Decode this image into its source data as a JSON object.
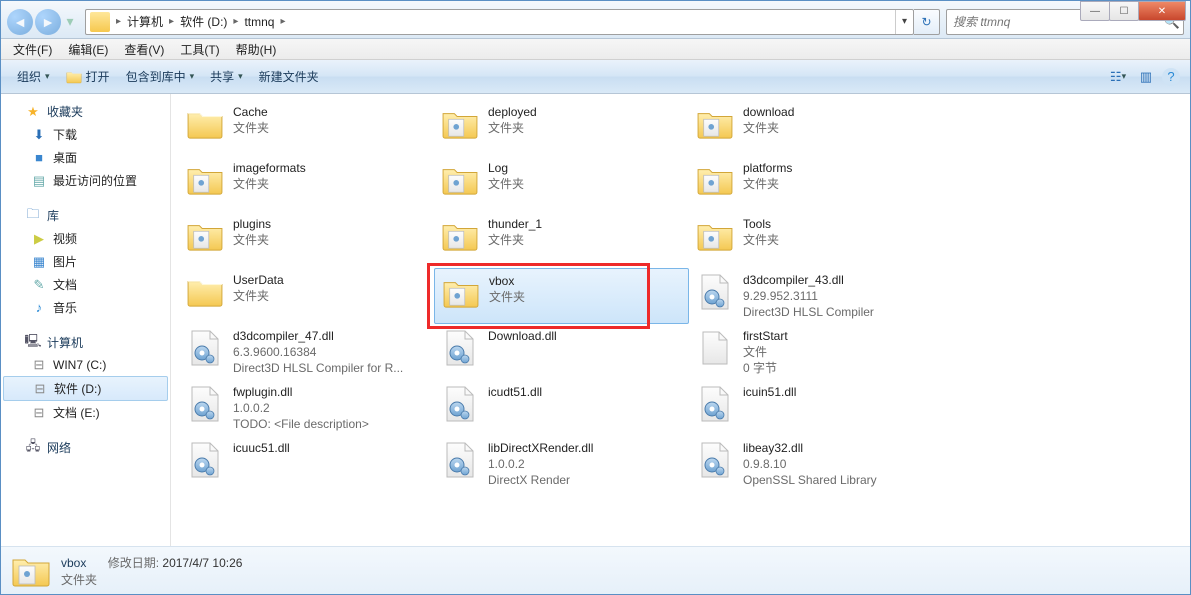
{
  "win_controls": {
    "min": "—",
    "max": "☐",
    "close": "✕"
  },
  "address": {
    "segments": [
      "计算机",
      "软件 (D:)",
      "ttmnq"
    ],
    "refresh_glyph": "↻",
    "dropdown_glyph": "▾"
  },
  "search": {
    "placeholder": "搜索 ttmnq",
    "icon_glyph": "🔍"
  },
  "menubar": [
    "文件(F)",
    "编辑(E)",
    "查看(V)",
    "工具(T)",
    "帮助(H)"
  ],
  "toolbar": {
    "organize": "组织",
    "open": "打开",
    "include": "包含到库中",
    "share": "共享",
    "newfolder": "新建文件夹",
    "drop": "▾",
    "view_glyph": "☷",
    "preview_glyph": "▥",
    "help_glyph": "?"
  },
  "sidebar": {
    "favorites": {
      "label": "收藏夹",
      "star": "★",
      "items": [
        {
          "icon": "⬇",
          "label": "下载",
          "color": "#2a6fb6"
        },
        {
          "icon": "■",
          "label": "桌面",
          "color": "#3a86cf"
        },
        {
          "icon": "▤",
          "label": "最近访问的位置",
          "color": "#6aa"
        }
      ]
    },
    "libraries": {
      "label": "库",
      "icon": "🗀",
      "items": [
        {
          "icon": "▶",
          "label": "视频",
          "color": "#cc4"
        },
        {
          "icon": "▦",
          "label": "图片",
          "color": "#3a86cf"
        },
        {
          "icon": "✎",
          "label": "文档",
          "color": "#6aa"
        },
        {
          "icon": "♪",
          "label": "音乐",
          "color": "#2a8ad6"
        }
      ]
    },
    "computer": {
      "label": "计算机",
      "icon": "🖳",
      "items": [
        {
          "icon": "⊟",
          "label": "WIN7 (C:)"
        },
        {
          "icon": "⊟",
          "label": "软件 (D:)",
          "selected": true
        },
        {
          "icon": "⊟",
          "label": "文档 (E:)"
        }
      ]
    },
    "network": {
      "label": "网络",
      "icon": "🖧"
    }
  },
  "files": [
    {
      "name": "Cache",
      "sub": "文件夹",
      "type": "folder"
    },
    {
      "name": "deployed",
      "sub": "文件夹",
      "type": "folder-special"
    },
    {
      "name": "download",
      "sub": "文件夹",
      "type": "folder-special"
    },
    {
      "name": "imageformats",
      "sub": "文件夹",
      "type": "folder-special"
    },
    {
      "name": "Log",
      "sub": "文件夹",
      "type": "folder-special"
    },
    {
      "name": "platforms",
      "sub": "文件夹",
      "type": "folder-special"
    },
    {
      "name": "plugins",
      "sub": "文件夹",
      "type": "folder-special"
    },
    {
      "name": "thunder_1",
      "sub": "文件夹",
      "type": "folder-special"
    },
    {
      "name": "Tools",
      "sub": "文件夹",
      "type": "folder-special"
    },
    {
      "name": "UserData",
      "sub": "文件夹",
      "type": "folder"
    },
    {
      "name": "vbox",
      "sub": "文件夹",
      "type": "folder-special",
      "selected": true,
      "redbox": true
    },
    {
      "name": "d3dcompiler_43.dll",
      "sub": "9.29.952.3111",
      "sub2": "Direct3D HLSL Compiler",
      "type": "dll"
    },
    {
      "name": "d3dcompiler_47.dll",
      "sub": "6.3.9600.16384",
      "sub2": "Direct3D HLSL Compiler for R...",
      "type": "dll"
    },
    {
      "name": "Download.dll",
      "sub": "",
      "type": "dll"
    },
    {
      "name": "firstStart",
      "sub": "文件",
      "sub2": "0 字节",
      "type": "file"
    },
    {
      "name": "fwplugin.dll",
      "sub": "1.0.0.2",
      "sub2": "TODO: <File description>",
      "type": "dll"
    },
    {
      "name": "icudt51.dll",
      "sub": "",
      "type": "dll"
    },
    {
      "name": "icuin51.dll",
      "sub": "",
      "type": "dll"
    },
    {
      "name": "icuuc51.dll",
      "sub": "",
      "type": "dll"
    },
    {
      "name": "libDirectXRender.dll",
      "sub": "1.0.0.2",
      "sub2": "DirectX Render",
      "type": "dll"
    },
    {
      "name": "libeay32.dll",
      "sub": "0.9.8.10",
      "sub2": "OpenSSL Shared Library",
      "type": "dll"
    }
  ],
  "details": {
    "name": "vbox",
    "type_label": "文件夹",
    "mod_label": "修改日期:",
    "mod_value": "2017/4/7 10:26"
  }
}
